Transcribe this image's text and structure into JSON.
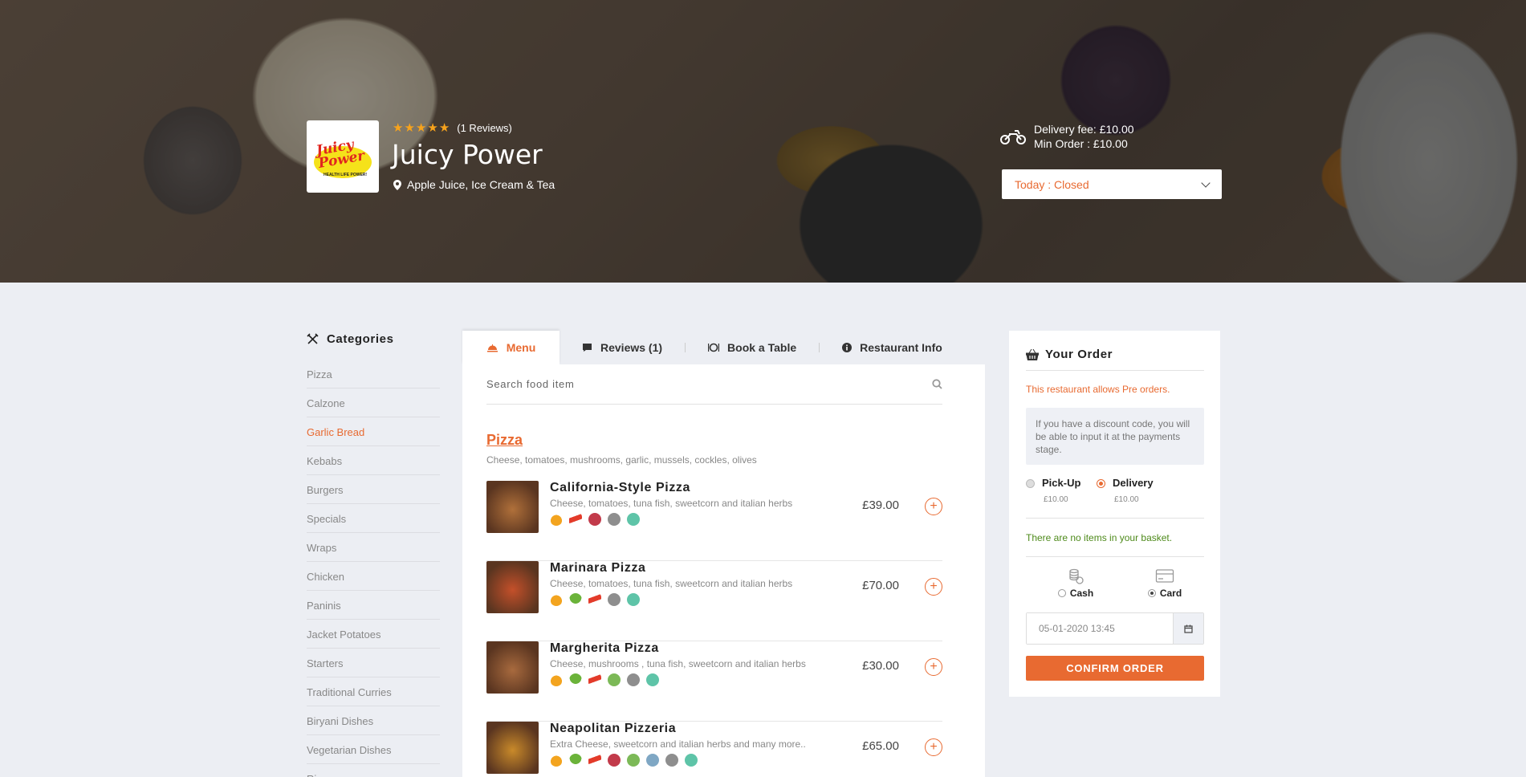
{
  "restaurant": {
    "logo_text": "Juicy Power",
    "logo_tagline": "HEALTH LIFE POWER!",
    "rating_stars": 5,
    "reviews_label": "(1 Reviews)",
    "name": "Juicy Power",
    "tags": "Apple Juice, Ice Cream & Tea",
    "delivery_fee": "Delivery fee: £10.00",
    "min_order": "Min Order : £10.00",
    "today_status": "Today : Closed"
  },
  "categories": {
    "heading": "Categories",
    "items": [
      {
        "label": "Pizza",
        "active": false
      },
      {
        "label": "Calzone",
        "active": false
      },
      {
        "label": "Garlic Bread",
        "active": true
      },
      {
        "label": "Kebabs",
        "active": false
      },
      {
        "label": "Burgers",
        "active": false
      },
      {
        "label": "Specials",
        "active": false
      },
      {
        "label": "Wraps",
        "active": false
      },
      {
        "label": "Chicken",
        "active": false
      },
      {
        "label": "Paninis",
        "active": false
      },
      {
        "label": "Jacket Potatoes",
        "active": false
      },
      {
        "label": "Starters",
        "active": false
      },
      {
        "label": "Traditional Curries",
        "active": false
      },
      {
        "label": "Biryani Dishes",
        "active": false
      },
      {
        "label": "Vegetarian Dishes",
        "active": false
      },
      {
        "label": "Rice",
        "active": false
      }
    ]
  },
  "tabs": {
    "menu": "Menu",
    "reviews": "Reviews (1)",
    "book": "Book a Table",
    "info": "Restaurant Info"
  },
  "search": {
    "placeholder": "Search food item"
  },
  "section": {
    "title": "Pizza",
    "description": "Cheese, tomatoes, mushrooms, garlic, mussels, cockles, olives"
  },
  "items": [
    {
      "name": "California-Style Pizza",
      "description": "Cheese, tomatoes, tuna fish, sweetcorn and italian herbs",
      "price": "£39.00",
      "icons": [
        "onion-icon",
        "chili-icon",
        "heart-icon",
        "grey-icon",
        "teal-icon"
      ],
      "image_color": "#b0703a"
    },
    {
      "name": "Marinara Pizza",
      "description": "Cheese, tomatoes, tuna fish, sweetcorn and italian herbs",
      "price": "£70.00",
      "icons": [
        "onion-icon",
        "broccoli-icon",
        "chili-icon",
        "grey-icon",
        "teal-icon"
      ],
      "image_color": "#c4502a"
    },
    {
      "name": "Margherita Pizza",
      "description": "Cheese, mushrooms , tuna fish, sweetcorn and italian herbs",
      "price": "£30.00",
      "icons": [
        "onion-icon",
        "broccoli-icon",
        "chili-icon",
        "green-icon",
        "grey-icon",
        "teal-icon"
      ],
      "image_color": "#a86a3e"
    },
    {
      "name": "Neapolitan Pizzeria",
      "description": "Extra Cheese, sweetcorn and italian herbs and many more..",
      "price": "£65.00",
      "icons": [
        "onion-icon",
        "broccoli-icon",
        "chili-icon",
        "heart-icon",
        "green-icon",
        "blue-icon",
        "grey-icon",
        "teal-icon"
      ],
      "image_color": "#c98a2a"
    }
  ],
  "order": {
    "heading": "Your Order",
    "preorder_note": "This restaurant allows Pre orders.",
    "discount_note": "If you have a discount code, you will be able to input it at the payments stage.",
    "pickup_label": "Pick-Up",
    "pickup_fee": "£10.00",
    "delivery_label": "Delivery",
    "delivery_fee": "£10.00",
    "selected_method": "Delivery",
    "basket_note": "There are no items in your basket.",
    "cash_label": "Cash",
    "card_label": "Card",
    "selected_payment": "Card",
    "datetime_value": "05-01-2020 13:45",
    "confirm_label": "CONFIRM ORDER"
  },
  "colors": {
    "accent": "#e86a31",
    "star": "#f7a31c",
    "success": "#4e8a1b"
  }
}
